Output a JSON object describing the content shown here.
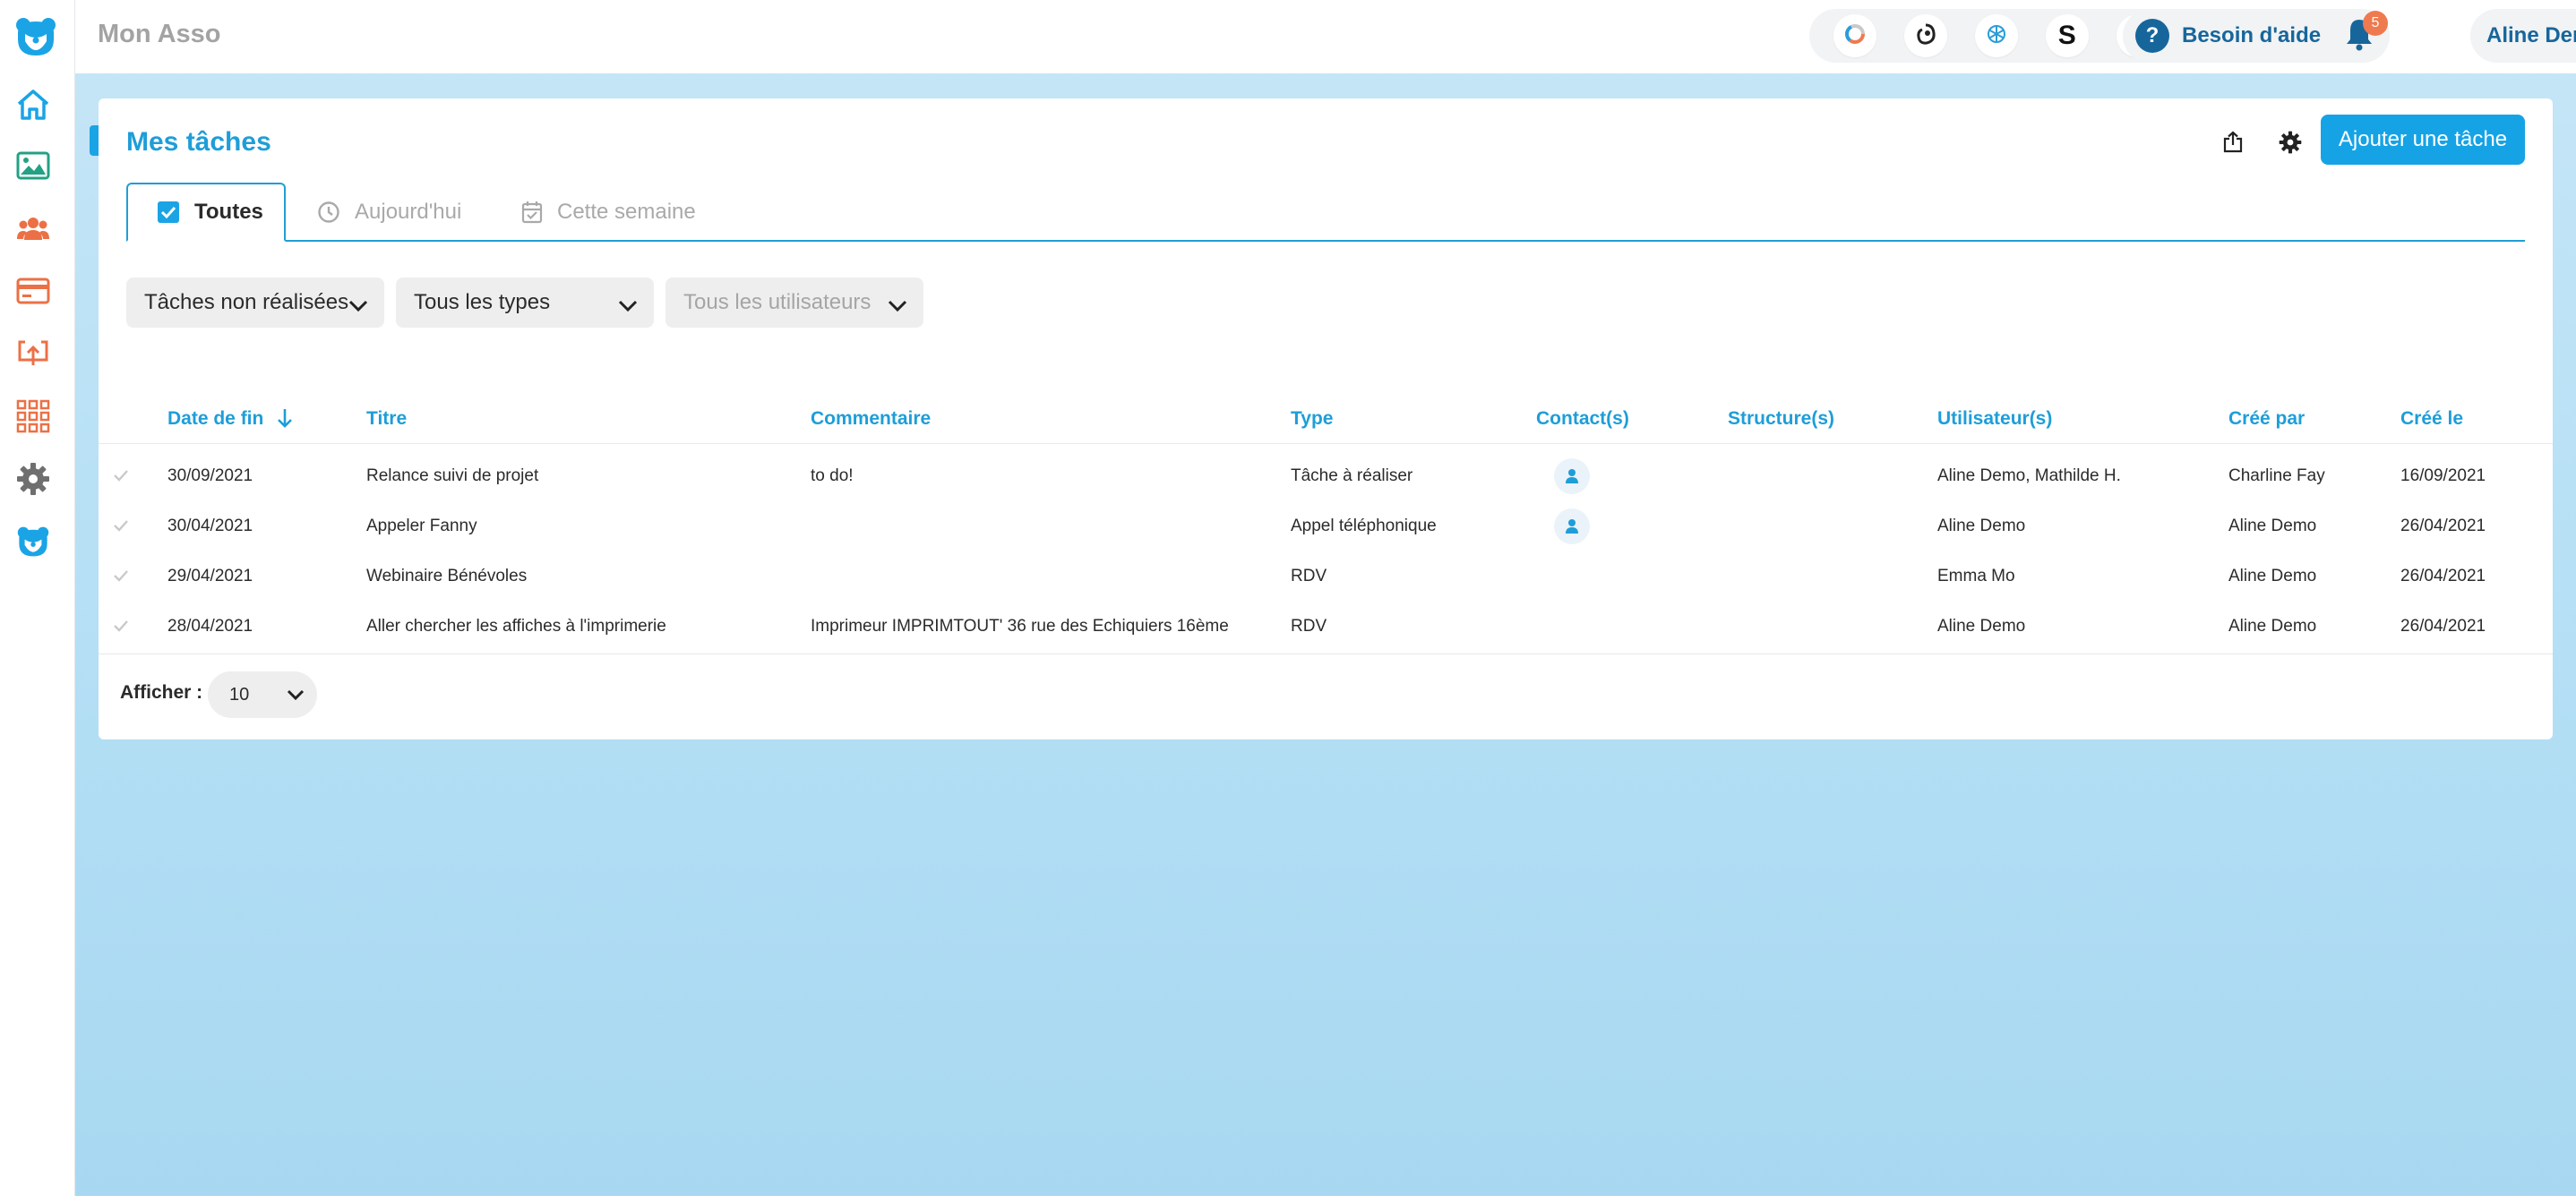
{
  "app": {
    "title": "Mon Asso"
  },
  "header": {
    "help_label": "Besoin d'aide",
    "notification_count": "5",
    "user_name": "Aline Demo",
    "integrations": [
      "donut-chart-icon",
      "mailchimp-icon",
      "openai-icon",
      "stripe-icon",
      "qr-code-icon"
    ],
    "stripe_letter": "S"
  },
  "page": {
    "title": "Mes tâches",
    "add_button": "Ajouter une tâche",
    "tabs": [
      {
        "label": "Toutes",
        "active": true
      },
      {
        "label": "Aujourd'hui",
        "active": false
      },
      {
        "label": "Cette semaine",
        "active": false
      }
    ],
    "filters": {
      "status": "Tâches non réalisées",
      "types": "Tous les types",
      "users": "Tous les utilisateurs"
    }
  },
  "table": {
    "columns": [
      "Date de fin",
      "Titre",
      "Commentaire",
      "Type",
      "Contact(s)",
      "Structure(s)",
      "Utilisateur(s)",
      "Créé par",
      "Créé le"
    ],
    "rows": [
      {
        "date": "30/09/2021",
        "title": "Relance suivi de projet",
        "comment": "to do!",
        "type": "Tâche à réaliser",
        "has_contact": true,
        "structure": "",
        "users": "Aline Demo, Mathilde H.",
        "created_by": "Charline Fay",
        "created_on": "16/09/2021"
      },
      {
        "date": "30/04/2021",
        "title": "Appeler Fanny",
        "comment": "",
        "type": "Appel téléphonique",
        "has_contact": true,
        "structure": "",
        "users": "Aline Demo",
        "created_by": "Aline Demo",
        "created_on": "26/04/2021"
      },
      {
        "date": "29/04/2021",
        "title": "Webinaire Bénévoles",
        "comment": "",
        "type": "RDV",
        "has_contact": false,
        "structure": "",
        "users": "Emma Mo",
        "created_by": "Aline Demo",
        "created_on": "26/04/2021"
      },
      {
        "date": "28/04/2021",
        "title": "Aller chercher les affiches à l'imprimerie",
        "comment": "Imprimeur IMPRIMTOUT' 36 rue des Echiquiers 16ème",
        "type": "RDV",
        "has_contact": false,
        "structure": "",
        "users": "Aline Demo",
        "created_by": "Aline Demo",
        "created_on": "26/04/2021"
      }
    ],
    "page_size_label": "Afficher :",
    "page_size": "10"
  },
  "colors": {
    "primary": "#1e9ed8",
    "button": "#16a3e6",
    "dark_blue": "#17669b",
    "accent_orange": "#ef7a4f"
  }
}
